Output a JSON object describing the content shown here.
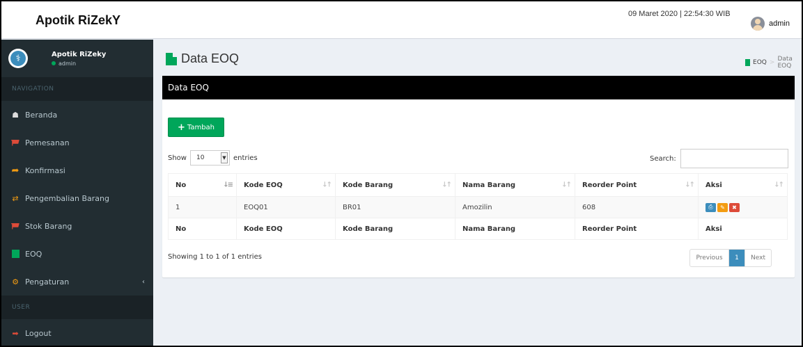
{
  "header": {
    "brand": "Apotik RiZekY",
    "datetime": "09 Maret 2020 | 22:54:30 WIB",
    "user": "admin"
  },
  "sidebar": {
    "user_name": "Apotik RiZeky",
    "user_status": "admin",
    "nav_header": "NAVIGATION",
    "items": [
      {
        "label": "Beranda",
        "icon": "home-icon"
      },
      {
        "label": "Pemesanan",
        "icon": "cart-icon"
      },
      {
        "label": "Konfirmasi",
        "icon": "share-icon"
      },
      {
        "label": "Pengembalian Barang",
        "icon": "exchange-icon"
      },
      {
        "label": "Stok Barang",
        "icon": "cart-icon"
      },
      {
        "label": "EOQ",
        "icon": "file-icon"
      },
      {
        "label": "Pengaturan",
        "icon": "gears-icon"
      }
    ],
    "user_header": "USER",
    "logout": "Logout"
  },
  "page": {
    "title": "Data EOQ",
    "breadcrumb": [
      "EOQ",
      "Data EOQ"
    ]
  },
  "box": {
    "title": "Data EOQ",
    "add_button": "Tambah",
    "show_label": "Show",
    "entries_value": "10",
    "entries_label": "entries",
    "search_label": "Search:",
    "columns": [
      "No",
      "Kode EOQ",
      "Kode Barang",
      "Nama Barang",
      "Reorder Point",
      "Aksi"
    ],
    "rows": [
      {
        "no": "1",
        "kode_eoq": "EOQ01",
        "kode_barang": "BR01",
        "nama_barang": "Amozilin",
        "reorder_point": "608"
      }
    ],
    "info": "Showing 1 to 1 of 1 entries",
    "pager": {
      "prev": "Previous",
      "current": "1",
      "next": "Next"
    }
  },
  "colors": {
    "sidebar_bg": "#222d32",
    "accent_green": "#00a65a",
    "accent_blue": "#3c8dbc",
    "accent_orange": "#f39c12",
    "accent_red": "#dd4b39"
  }
}
